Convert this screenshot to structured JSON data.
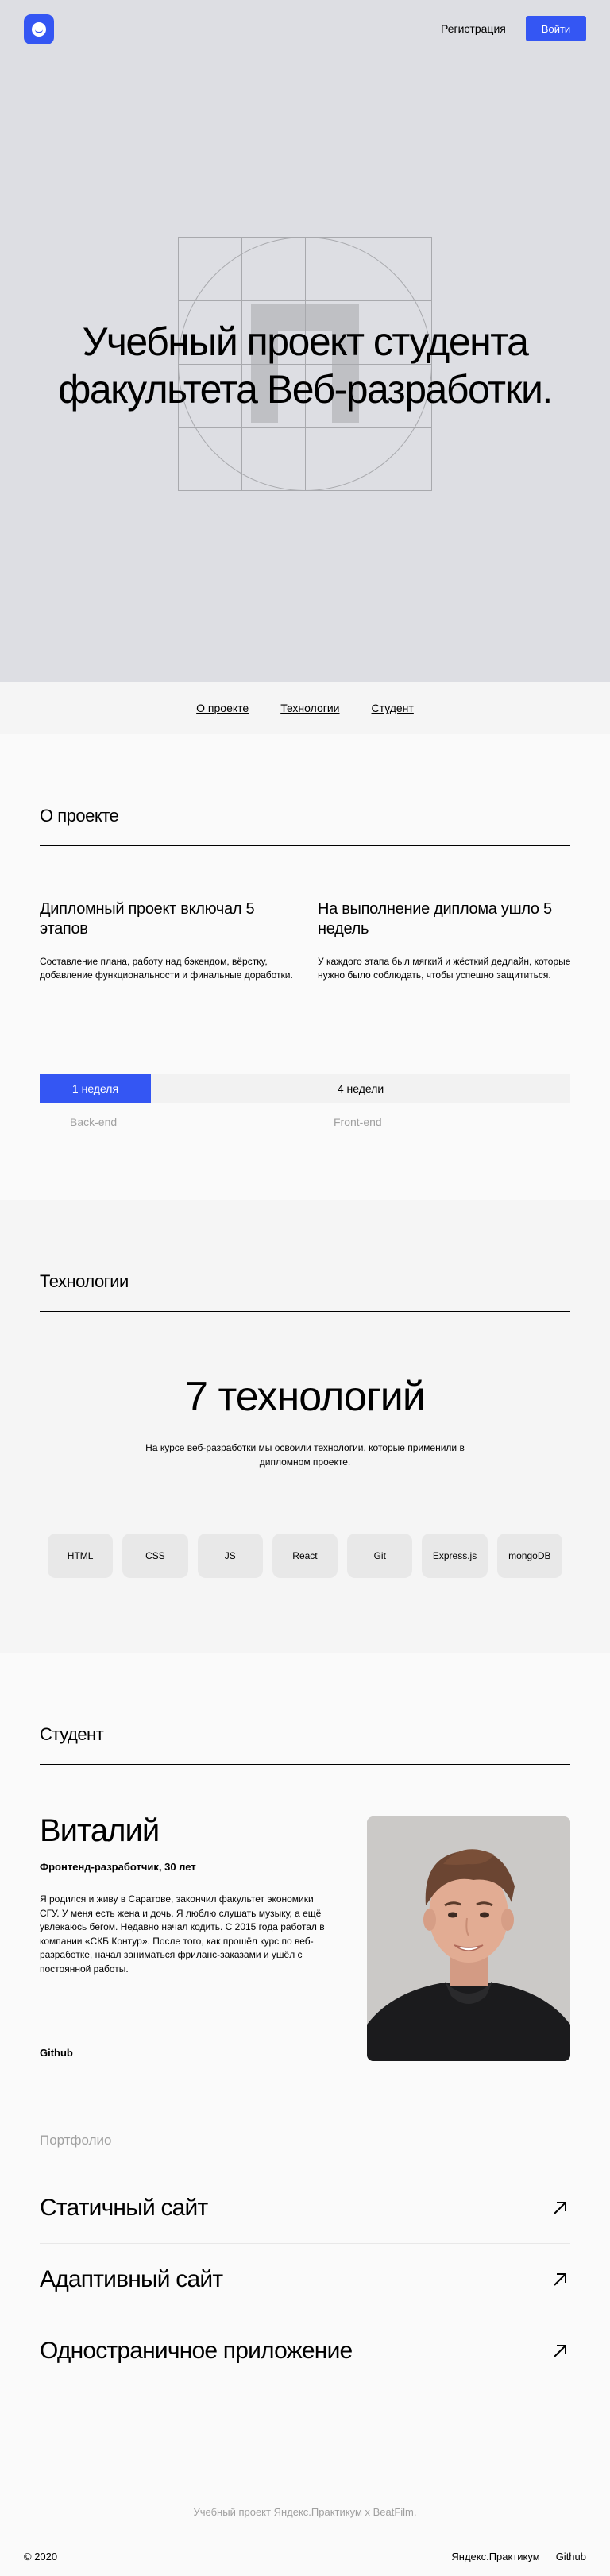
{
  "header": {
    "logo_icon": "smiley-logo-icon",
    "register_label": "Регистрация",
    "login_label": "Войти"
  },
  "hero": {
    "title_line1": "Учебный проект студента",
    "title_line2": "факультета Веб-разработки."
  },
  "section_nav": {
    "items": [
      {
        "label": "О проекте"
      },
      {
        "label": "Технологии"
      },
      {
        "label": "Студент"
      }
    ]
  },
  "about": {
    "title": "О проекте",
    "col1_title": "Дипломный проект включал 5 этапов",
    "col1_text": "Составление плана, работу над бэкендом, вёрстку, добавление функциональности и финальные доработки.",
    "col2_title": "На выполнение диплома ушло 5 недель",
    "col2_text": "У каждого этапа был мягкий и жёсткий дедлайн, которые нужно было соблюдать, чтобы успешно защититься.",
    "timeline_backend": "1 неделя",
    "timeline_frontend": "4 недели",
    "label_backend": "Back-end",
    "label_frontend": "Front-end"
  },
  "tech": {
    "title": "Технологии",
    "headline": "7 технологий",
    "description": "На курсе веб-разработки мы освоили технологии, которые применили в дипломном проекте.",
    "items": [
      "HTML",
      "CSS",
      "JS",
      "React",
      "Git",
      "Express.js",
      "mongoDB"
    ]
  },
  "student": {
    "title": "Студент",
    "name": "Виталий",
    "role": "Фронтенд-разработчик, 30 лет",
    "bio": "Я родился и живу в Саратове, закончил факультет экономики СГУ. У меня есть жена и дочь. Я люблю слушать музыку, а ещё увлекаюсь бегом. Недавно начал кодить. С 2015 года работал в компании «СКБ Контур». После того, как прошёл курс по веб-разработке, начал заниматься фриланс-заказами и ушёл с постоянной работы.",
    "github_label": "Github",
    "portfolio_label": "Портфолио",
    "portfolio": [
      {
        "label": "Статичный сайт"
      },
      {
        "label": "Адаптивный сайт"
      },
      {
        "label": "Одностраничное приложение"
      }
    ],
    "arrow_icon": "arrow-up-right-icon"
  },
  "footer": {
    "note": "Учебный проект Яндекс.Практикум х BeatFilm.",
    "copyright": "© 2020",
    "link_practicum": "Яндекс.Практикум",
    "link_github": "Github"
  }
}
